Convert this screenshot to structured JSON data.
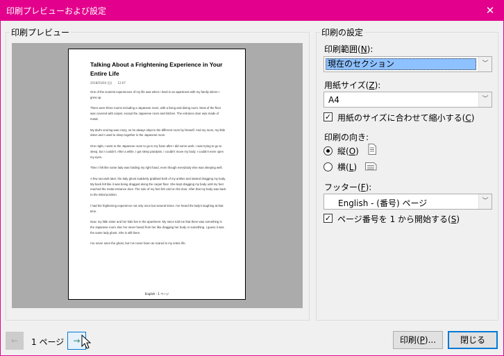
{
  "window": {
    "title": "印刷プレビューおよび設定",
    "close_glyph": "✕",
    "accent": "#e3008c"
  },
  "preview": {
    "label": "印刷プレビュー",
    "page": {
      "title": "Talking About a Frightening Experience in Your Entire Life",
      "date": "2018/03/04 (日)　　12:07",
      "paragraphs": [
        "One of the scariest experiences of my life was when I lived in an apartment with my family where I grew up.",
        "There were three rooms including a Japanese room, with a living and dining room. Most of the floor was covered with carpet, except the Japanese room and kitchen. The entrance door was made of metal.",
        "My dad's snoring was crazy, so he always slept in the different room by himself. And my mom, my little sister and I used to sleep together in the Japanese room.",
        "One night, I went to the Japanese room to go to my futon after I did some work. I was trying to go to sleep, but I couldn't. After a while, I got sleep paralysis. I couldn't move my body. I couldn't even open my eyes.",
        "Then I felt like some lady was holding my right hand, even though everybody else was sleeping well.",
        "A few seconds later, the lady ghost suddenly grabbed both of my ankles and started dragging my body. My back felt like it was being dragged along the carpet floor. She kept dragging my body until my feet reached the metal entrance door. The sole of my feet felt cold on the door. After that my body was back to the initial position.",
        "I had the frightening experience not only once but several times. I've heard the lady's laughing at that time.",
        "Now, my little sister and her kids live in the apartment. My niece told me that there was something in the Japanese room. But I've never heard from her like dragging her body or something. I guess it was the same lady ghost. She is still there.",
        "I've never seen the ghost, but I've never been as scared in my entire life."
      ],
      "footer": "English - 1 ページ"
    }
  },
  "settings": {
    "label": "印刷の設定",
    "range": {
      "label": "印刷範囲(",
      "key": "N",
      "end": "):",
      "value": "現在のセクション"
    },
    "paper": {
      "label": "用紙サイズ(",
      "key": "Z",
      "end": "):",
      "value": "A4"
    },
    "fit": {
      "label": "用紙のサイズに合わせて縮小する(",
      "key": "C",
      "end": ")",
      "checked": true
    },
    "orientation": {
      "label": "印刷の向き:",
      "portrait": "縦(",
      "portrait_key": "O",
      "landscape": "横(",
      "landscape_key": "L",
      "end": ")",
      "selected": "portrait"
    },
    "footer": {
      "label": "フッター(",
      "key": "F",
      "end": "):",
      "value": "English - (番号) ページ"
    },
    "start1": {
      "label": "ページ番号を 1 から開始する(",
      "key": "S",
      "end": ")",
      "checked": true
    }
  },
  "nav": {
    "page_label": "1 ページ",
    "prev_icon": "arrow-left-icon",
    "next_icon": "arrow-right-icon"
  },
  "buttons": {
    "print": "印刷(",
    "print_key": "P",
    "print_end": ")...",
    "close": "閉じる"
  }
}
